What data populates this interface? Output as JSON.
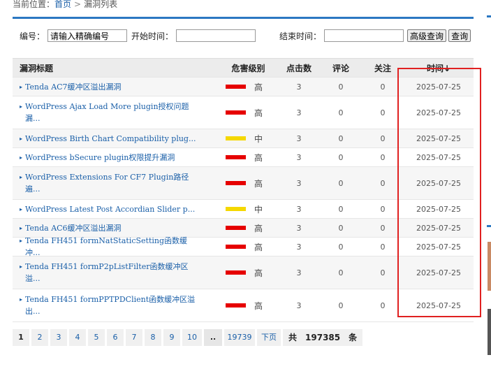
{
  "breadcrumb": {
    "label": "当前位置：",
    "home": "首页",
    "separator": ">",
    "current": "漏洞列表"
  },
  "filters": {
    "id_label": "编号：",
    "id_value": "请输入精确编号",
    "start_label": "开始时间：",
    "start_value": "",
    "end_label": "结束时间：",
    "end_value": "",
    "advanced_button": "高级查询",
    "search_button": "查询"
  },
  "table": {
    "headers": {
      "title": "漏洞标题",
      "level": "危害级别",
      "clicks": "点击数",
      "comments": "评论",
      "follow": "关注",
      "time": "时间↓"
    },
    "rows": [
      {
        "title": "Tenda AC7缓冲区溢出漏洞",
        "level": "高",
        "level_color": "#e60000",
        "clicks": "3",
        "comments": "0",
        "follow": "0",
        "date": "2025-07-25"
      },
      {
        "title": "WordPress Ajax Load More plugin授权问题漏...",
        "level": "高",
        "level_color": "#e60000",
        "clicks": "3",
        "comments": "0",
        "follow": "0",
        "date": "2025-07-25"
      },
      {
        "title": "WordPress Birth Chart Compatibility plug...",
        "level": "中",
        "level_color": "#f5d800",
        "clicks": "3",
        "comments": "0",
        "follow": "0",
        "date": "2025-07-25"
      },
      {
        "title": "WordPress bSecure plugin权限提升漏洞",
        "level": "高",
        "level_color": "#e60000",
        "clicks": "3",
        "comments": "0",
        "follow": "0",
        "date": "2025-07-25"
      },
      {
        "title": "WordPress Extensions For CF7 Plugin路径遍...",
        "level": "高",
        "level_color": "#e60000",
        "clicks": "3",
        "comments": "0",
        "follow": "0",
        "date": "2025-07-25"
      },
      {
        "title": "WordPress Latest Post Accordian Slider p...",
        "level": "中",
        "level_color": "#f5d800",
        "clicks": "3",
        "comments": "0",
        "follow": "0",
        "date": "2025-07-25"
      },
      {
        "title": "Tenda AC6缓冲区溢出漏洞",
        "level": "高",
        "level_color": "#e60000",
        "clicks": "3",
        "comments": "0",
        "follow": "0",
        "date": "2025-07-25"
      },
      {
        "title": "Tenda FH451 formNatStaticSetting函数缓冲...",
        "level": "高",
        "level_color": "#e60000",
        "clicks": "3",
        "comments": "0",
        "follow": "0",
        "date": "2025-07-25"
      },
      {
        "title": "Tenda FH451 formP2pListFilter函数缓冲区溢...",
        "level": "高",
        "level_color": "#e60000",
        "clicks": "3",
        "comments": "0",
        "follow": "0",
        "date": "2025-07-25"
      },
      {
        "title": "Tenda FH451 formPPTPDClient函数缓冲区溢出...",
        "level": "高",
        "level_color": "#e60000",
        "clicks": "3",
        "comments": "0",
        "follow": "0",
        "date": "2025-07-25"
      }
    ]
  },
  "pagination": {
    "pages": [
      "1",
      "2",
      "3",
      "4",
      "5",
      "6",
      "7",
      "8",
      "9",
      "10"
    ],
    "current": "1",
    "ellipsis": "..",
    "last": "19739",
    "next": "下页",
    "total_prefix": "共",
    "total_count": "197385",
    "total_suffix": "条"
  },
  "icons": {
    "row_arrow": "triangle-right-icon"
  }
}
